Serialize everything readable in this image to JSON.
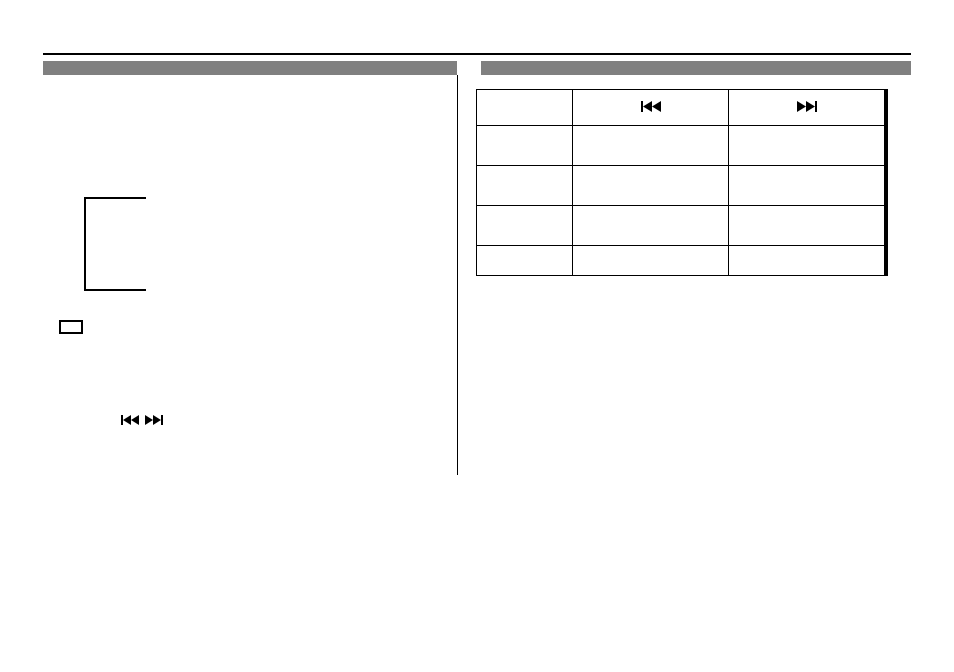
{
  "icons": {
    "skip_back": "skip-back-icon",
    "skip_fwd": "skip-forward-icon"
  },
  "table": {
    "header": {
      "col1_icon": "skip-back-icon",
      "col2_icon": "skip-forward-icon"
    },
    "rows": [
      {
        "label": "",
        "back": "",
        "fwd": ""
      },
      {
        "label": "",
        "back": "",
        "fwd": ""
      },
      {
        "label": "",
        "back": "",
        "fwd": ""
      },
      {
        "label": "",
        "back": "",
        "fwd": ""
      }
    ]
  }
}
